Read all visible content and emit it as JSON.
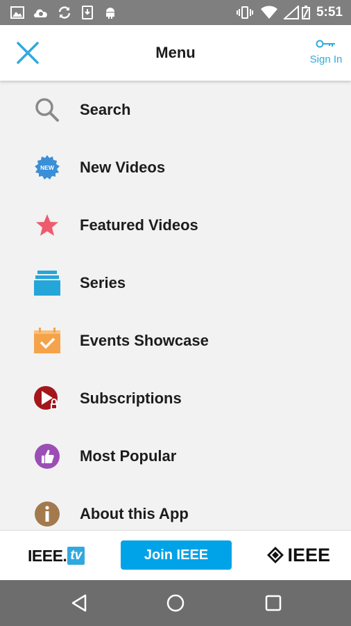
{
  "status_bar": {
    "time": "5:51",
    "left_icons": [
      "image-icon",
      "cloud-icon",
      "sync-icon",
      "phone-download-icon",
      "android-icon"
    ],
    "right_icons": [
      "vibrate-icon",
      "wifi-icon",
      "battery-icon"
    ]
  },
  "header": {
    "title": "Menu",
    "close_icon": "close-icon",
    "sign_in_label": "Sign In",
    "sign_in_icon": "key-icon",
    "accent_color": "#30a9de"
  },
  "menu": {
    "items": [
      {
        "label": "Search",
        "icon": "search-icon",
        "color": "#8a8a8a"
      },
      {
        "label": "New Videos",
        "icon": "new-badge-icon",
        "color": "#3b8fd6",
        "badge_text": "NEW"
      },
      {
        "label": "Featured Videos",
        "icon": "star-icon",
        "color": "#ef5b6c"
      },
      {
        "label": "Series",
        "icon": "stack-icon",
        "color": "#25a6d9"
      },
      {
        "label": "Events Showcase",
        "icon": "calendar-check-icon",
        "color": "#f5a34a"
      },
      {
        "label": "Subscriptions",
        "icon": "play-lock-icon",
        "color": "#a4161b"
      },
      {
        "label": "Most Popular",
        "icon": "thumbs-up-icon",
        "color": "#9b4fb4"
      },
      {
        "label": "About this App",
        "icon": "info-icon",
        "color": "#a27a4d"
      }
    ]
  },
  "footer": {
    "ieeetv_text": "IEEE.",
    "ieeetv_badge": "tv",
    "join_label": "Join IEEE",
    "ieee_text": "IEEE",
    "join_color": "#00a3e8"
  },
  "nav_bar": {
    "buttons": [
      "back-icon",
      "home-icon",
      "recents-icon"
    ]
  }
}
